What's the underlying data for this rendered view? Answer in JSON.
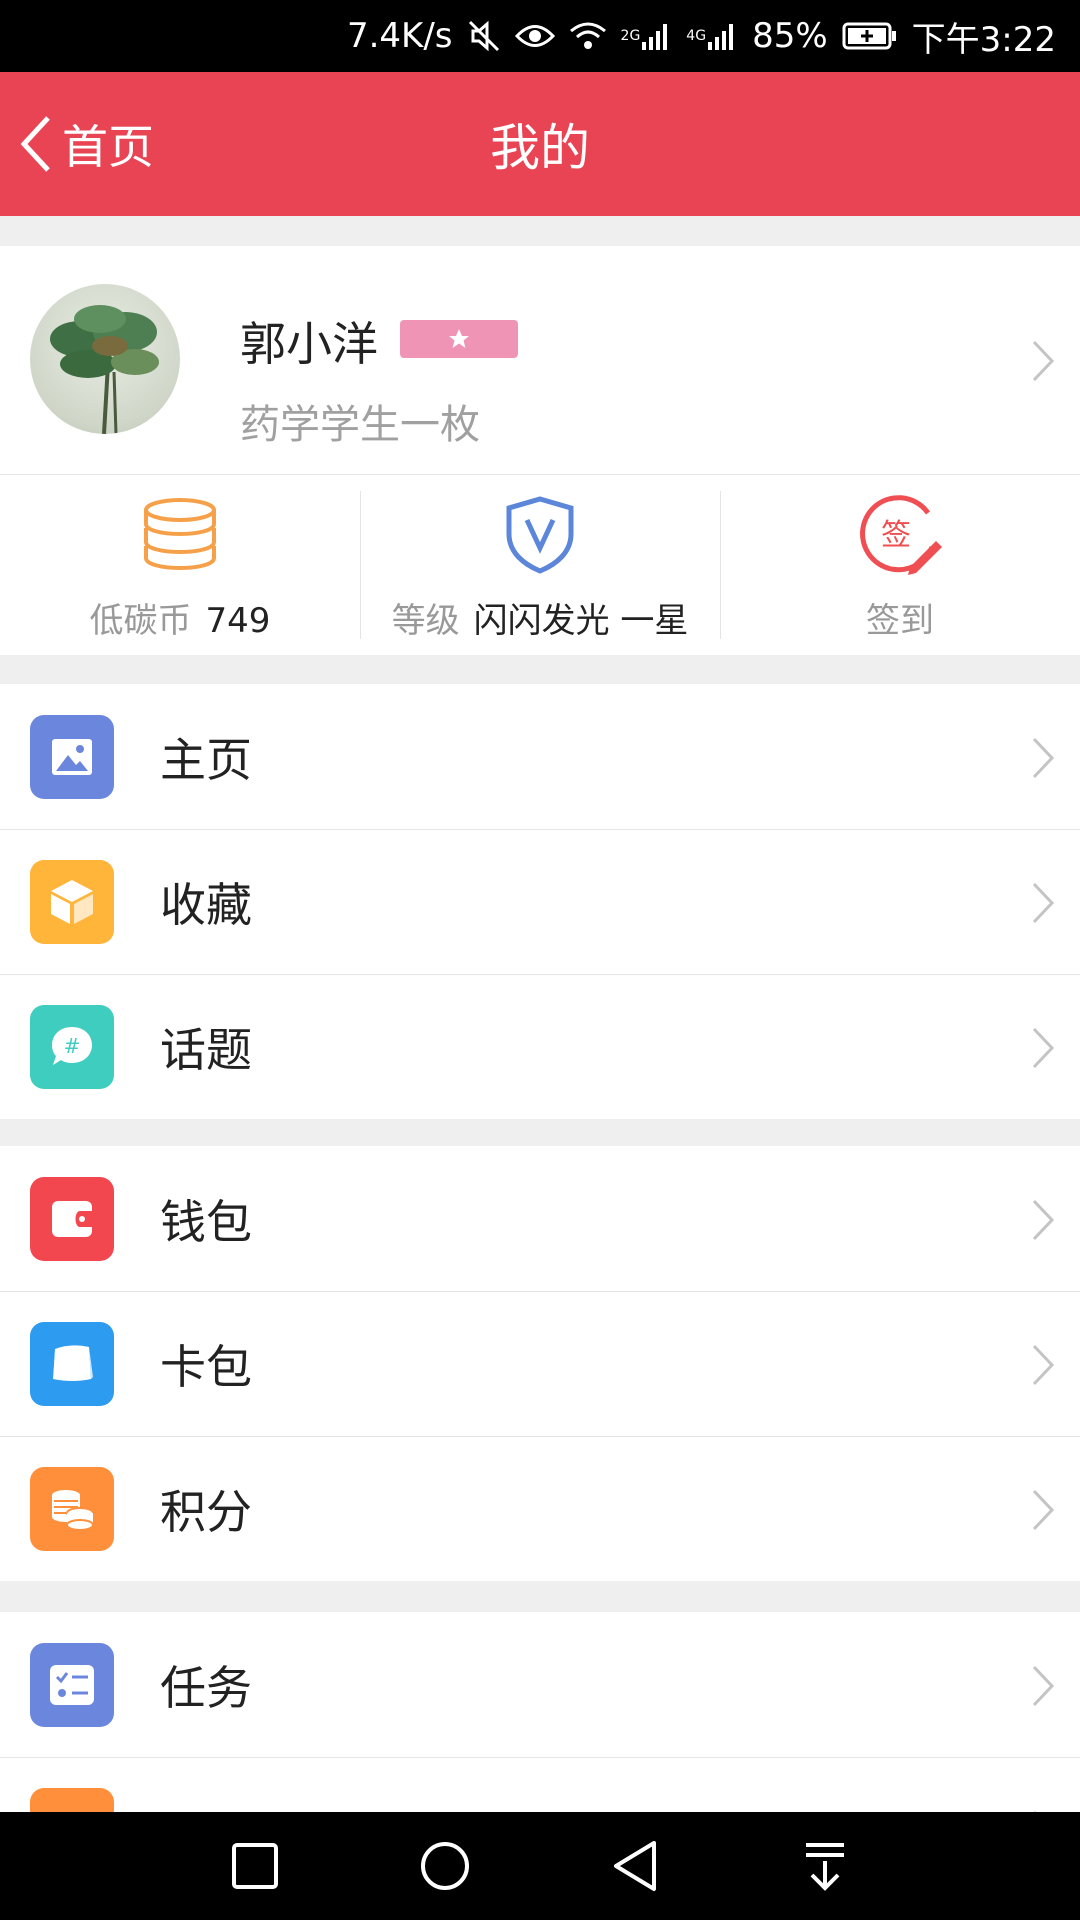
{
  "status_bar": {
    "net_speed": "7.4K/s",
    "signal_2g": "2G",
    "signal_4g": "4G",
    "battery": "85%",
    "time": "下午3:22"
  },
  "nav": {
    "back_label": "首页",
    "title": "我的"
  },
  "profile": {
    "name": "郭小洋",
    "description": "药学学生一枚"
  },
  "stats": {
    "coins_label": "低碳币",
    "coins_value": "749",
    "level_label": "等级",
    "level_value": "闪闪发光 一星",
    "checkin_label": "签到",
    "checkin_icon_char": "签"
  },
  "menu": {
    "group1": [
      {
        "label": "主页",
        "icon": "image-icon",
        "color": "#6b87dd"
      },
      {
        "label": "收藏",
        "icon": "cube-icon",
        "color": "#ffb43a"
      },
      {
        "label": "话题",
        "icon": "hashtag-bubble-icon",
        "color": "#3fcdc0"
      }
    ],
    "group2": [
      {
        "label": "钱包",
        "icon": "wallet-icon",
        "color": "#f2474f"
      },
      {
        "label": "卡包",
        "icon": "card-icon",
        "color": "#2c9bf0"
      },
      {
        "label": "积分",
        "icon": "coins-icon",
        "color": "#ff8f3b"
      }
    ],
    "group3": [
      {
        "label": "任务",
        "icon": "task-list-icon",
        "color": "#6b87dd"
      }
    ]
  },
  "colors": {
    "accent": "#e84454",
    "badge": "#ef94b4"
  }
}
